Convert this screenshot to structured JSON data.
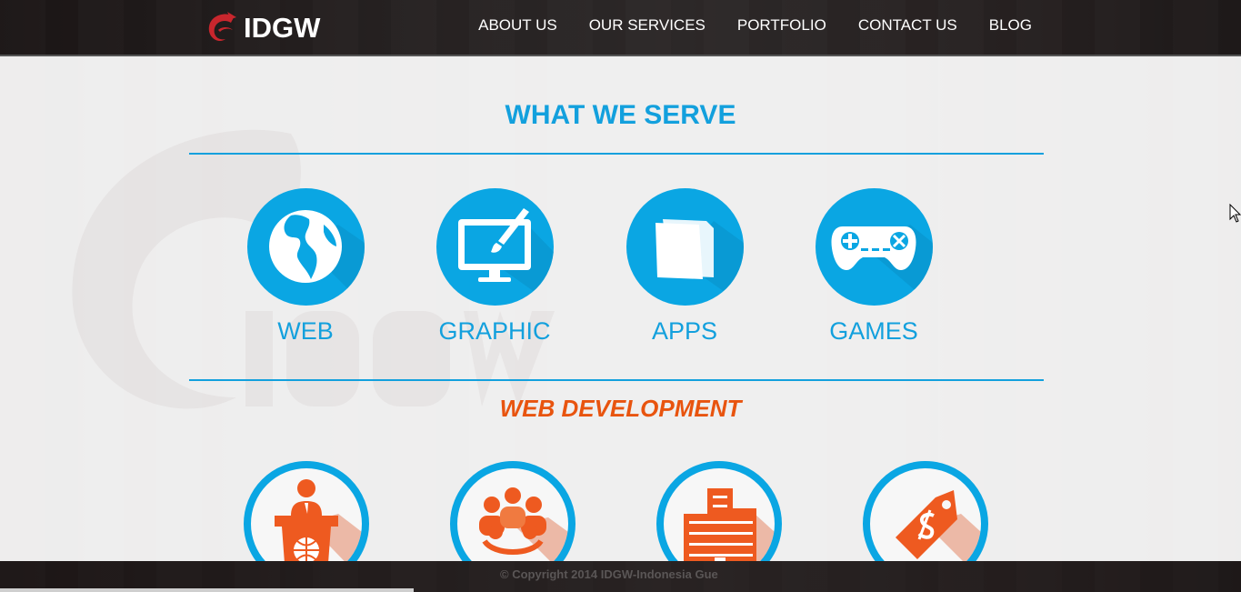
{
  "brand": {
    "logo_text": "IDGW",
    "logo_icon": "idgw-swirl-logo",
    "accent": "#13a0dd",
    "logo_red": "#c8262d"
  },
  "nav": {
    "items": [
      "ABOUT US",
      "OUR SERVICES",
      "PORTFOLIO",
      "CONTACT US",
      "BLOG"
    ]
  },
  "serve": {
    "title": "WHAT WE SERVE",
    "items": [
      {
        "label": "WEB",
        "icon": "globe-icon"
      },
      {
        "label": "GRAPHIC",
        "icon": "monitor-brush-icon"
      },
      {
        "label": "APPS",
        "icon": "pages-icon"
      },
      {
        "label": "GAMES",
        "icon": "gamepad-icon"
      }
    ]
  },
  "web_development": {
    "title": "WEB DEVELOPMENT",
    "color": "#e8540f",
    "features": [
      {
        "icon": "presenter-globe-icon"
      },
      {
        "icon": "team-group-icon"
      },
      {
        "icon": "buildings-icon"
      },
      {
        "icon": "price-tag-icon"
      }
    ]
  },
  "footer": {
    "copyright": "© Copyright 2014 IDGW-Indonesia Gue"
  }
}
